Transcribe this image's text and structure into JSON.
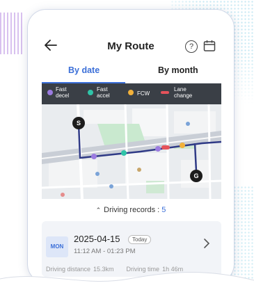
{
  "header": {
    "title": "My Route",
    "help_icon": "?"
  },
  "tabs": [
    {
      "label": "By date",
      "active": true
    },
    {
      "label": "By month",
      "active": false
    }
  ],
  "legend": [
    {
      "label": "Fast decel",
      "color": "#9b7be0"
    },
    {
      "label": "Fast accel",
      "color": "#2fc4a8"
    },
    {
      "label": "FCW",
      "color": "#f2b13a"
    },
    {
      "label": "Lane change",
      "color": "#e5525a"
    }
  ],
  "map": {
    "start_label": "S",
    "goal_label": "G",
    "route_color": "#2f3a86"
  },
  "records": {
    "label": "Driving records : ",
    "count": "5"
  },
  "record_card": {
    "day": "MON",
    "date": "2025-04-15",
    "today_label": "Today",
    "time_range": "11:12 AM - 01:23 PM",
    "distance_label": "Driving distance",
    "distance_value": "15.3km",
    "time_label": "Driving time",
    "time_value": "1h 46m"
  },
  "colors": {
    "accent": "#3b6fd8"
  }
}
